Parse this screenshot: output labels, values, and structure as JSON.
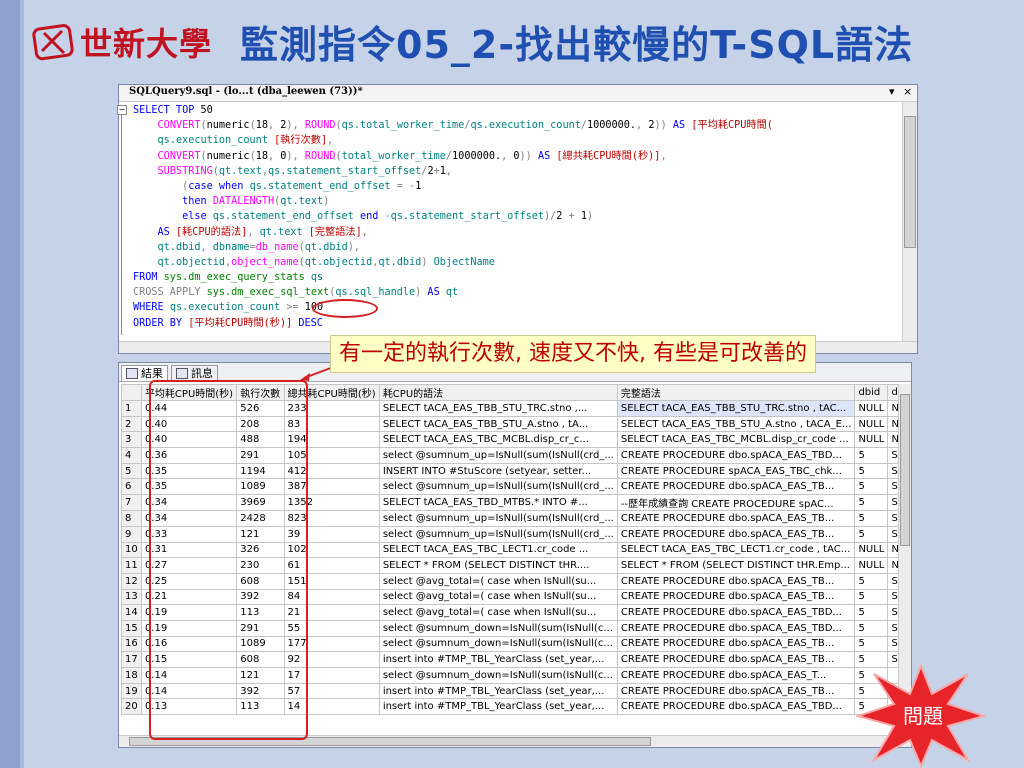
{
  "header": {
    "logo_text": "世新大學",
    "title": "監測指令05_2-找出較慢的T-SQL語法"
  },
  "editor": {
    "tab_name": "SQLQuery9.sql - (lo...t (dba_leewen (73))*",
    "dropdown": "▾",
    "close": "×",
    "lines": [
      [
        [
          "kw",
          "SELECT TOP "
        ],
        [
          "tx",
          "50"
        ]
      ],
      [
        [
          "tx",
          "    "
        ],
        [
          "fn",
          "CONVERT"
        ],
        [
          "gr",
          "("
        ],
        [
          "tx",
          "numeric"
        ],
        [
          "gr",
          "("
        ],
        [
          "tx",
          "18"
        ],
        [
          "gr",
          ", "
        ],
        [
          "tx",
          "2"
        ],
        [
          "gr",
          "), "
        ],
        [
          "fn",
          "ROUND"
        ],
        [
          "gr",
          "("
        ],
        [
          "tl",
          "qs.total_worker_time"
        ],
        [
          "gr",
          "/"
        ],
        [
          "tl",
          "qs.execution_count"
        ],
        [
          "gr",
          "/"
        ],
        [
          "tx",
          "1000000."
        ],
        [
          "gr",
          ", "
        ],
        [
          "tx",
          "2"
        ],
        [
          "gr",
          "))"
        ],
        [
          "kw",
          " AS "
        ],
        [
          "rd",
          "[平均耗CPU時間("
        ]
      ],
      [
        [
          "tx",
          "    "
        ],
        [
          "tl",
          "qs.execution_count"
        ],
        [
          "rd",
          " [執行次數]"
        ],
        [
          "gr",
          ","
        ]
      ],
      [
        [
          "tx",
          "    "
        ],
        [
          "fn",
          "CONVERT"
        ],
        [
          "gr",
          "("
        ],
        [
          "tx",
          "numeric"
        ],
        [
          "gr",
          "("
        ],
        [
          "tx",
          "18"
        ],
        [
          "gr",
          ", "
        ],
        [
          "tx",
          "0"
        ],
        [
          "gr",
          "), "
        ],
        [
          "fn",
          "ROUND"
        ],
        [
          "gr",
          "("
        ],
        [
          "tl",
          "total_worker_time"
        ],
        [
          "gr",
          "/"
        ],
        [
          "tx",
          "1000000."
        ],
        [
          "gr",
          ", "
        ],
        [
          "tx",
          "0"
        ],
        [
          "gr",
          "))"
        ],
        [
          "kw",
          " AS "
        ],
        [
          "rd",
          "[總共耗CPU時間(秒)]"
        ],
        [
          "gr",
          ","
        ]
      ],
      [
        [
          "tx",
          "    "
        ],
        [
          "fn",
          "SUBSTRING"
        ],
        [
          "gr",
          "("
        ],
        [
          "tl",
          "qt.text"
        ],
        [
          "gr",
          ","
        ],
        [
          "tl",
          "qs.statement_start_offset"
        ],
        [
          "gr",
          "/"
        ],
        [
          "tx",
          "2"
        ],
        [
          "gr",
          "+"
        ],
        [
          "tx",
          "1"
        ],
        [
          "gr",
          ","
        ]
      ],
      [
        [
          "tx",
          "        "
        ],
        [
          "gr",
          "("
        ],
        [
          "kw",
          "case when "
        ],
        [
          "tl",
          "qs.statement_end_offset"
        ],
        [
          "gr",
          " = -"
        ],
        [
          "tx",
          "1"
        ]
      ],
      [
        [
          "tx",
          "        "
        ],
        [
          "kw",
          "then "
        ],
        [
          "fn",
          "DATALENGTH"
        ],
        [
          "gr",
          "("
        ],
        [
          "tl",
          "qt.text"
        ],
        [
          "gr",
          ")"
        ]
      ],
      [
        [
          "tx",
          "        "
        ],
        [
          "kw",
          "else "
        ],
        [
          "tl",
          "qs.statement_end_offset"
        ],
        [
          "kw",
          " end "
        ],
        [
          "gr",
          "-"
        ],
        [
          "tl",
          "qs.statement_start_offset"
        ],
        [
          "gr",
          ")/"
        ],
        [
          "tx",
          "2"
        ],
        [
          "gr",
          " + "
        ],
        [
          "tx",
          "1"
        ],
        [
          "gr",
          ")"
        ]
      ],
      [
        [
          "tx",
          "    "
        ],
        [
          "kw",
          "AS "
        ],
        [
          "rd",
          "[耗CPU的語法]"
        ],
        [
          "gr",
          ", "
        ],
        [
          "tl",
          "qt.text"
        ],
        [
          "rd",
          " [完整語法]"
        ],
        [
          "gr",
          ","
        ]
      ],
      [
        [
          "tx",
          "    "
        ],
        [
          "tl",
          "qt.dbid"
        ],
        [
          "gr",
          ", "
        ],
        [
          "tl",
          "dbname"
        ],
        [
          "gr",
          "="
        ],
        [
          "fn",
          "db_name"
        ],
        [
          "gr",
          "("
        ],
        [
          "tl",
          "qt.dbid"
        ],
        [
          "gr",
          "),"
        ]
      ],
      [
        [
          "tx",
          "    "
        ],
        [
          "tl",
          "qt.objectid"
        ],
        [
          "gr",
          ","
        ],
        [
          "fn",
          "object_name"
        ],
        [
          "gr",
          "("
        ],
        [
          "tl",
          "qt.objectid"
        ],
        [
          "gr",
          ","
        ],
        [
          "tl",
          "qt.dbid"
        ],
        [
          "gr",
          ") "
        ],
        [
          "tl",
          "ObjectName"
        ]
      ],
      [
        [
          "kw",
          "FROM "
        ],
        [
          "sys",
          "sys.dm_exec_query_stats"
        ],
        [
          "tl",
          " qs"
        ]
      ],
      [
        [
          "gr",
          "CROSS APPLY "
        ],
        [
          "sys",
          "sys.dm_exec_sql_text"
        ],
        [
          "gr",
          "("
        ],
        [
          "tl",
          "qs.sql_handle"
        ],
        [
          "gr",
          ")"
        ],
        [
          "kw",
          " AS "
        ],
        [
          "tl",
          "qt"
        ]
      ],
      [
        [
          "kw",
          "WHERE "
        ],
        [
          "tl",
          "qs.execution_count "
        ],
        [
          "gr",
          ">= "
        ],
        [
          "tx",
          "100"
        ]
      ],
      [
        [
          "kw",
          "ORDER BY "
        ],
        [
          "rd",
          "[平均耗CPU時間(秒)]"
        ],
        [
          "kw",
          " DESC"
        ]
      ]
    ]
  },
  "callout": "有一定的執行次數, 速度又不快, 有些是可改善的",
  "results": {
    "tab_results": "結果",
    "tab_messages": "訊息",
    "columns": [
      "",
      "平均耗CPU時間(秒)",
      "執行次數",
      "總共耗CPU時間(秒)",
      "耗CPU的語法",
      "完整語法",
      "dbid",
      "dbi"
    ],
    "rows": [
      [
        "1",
        "0.44",
        "526",
        "233",
        "SELECT tACA_EAS_TBB_STU_TRC.stno ,...",
        "SELECT tACA_EAS_TBB_STU_TRC.stno , tAC...",
        "NULL",
        "NU"
      ],
      [
        "2",
        "0.40",
        "208",
        "83",
        "SELECT tACA_EAS_TBB_STU_A.stno , tA...",
        "SELECT tACA_EAS_TBB_STU_A.stno , tACA_E...",
        "NULL",
        "NU"
      ],
      [
        "3",
        "0.40",
        "488",
        "194",
        "SELECT tACA_EAS_TBC_MCBL.disp_cr_c...",
        "SELECT tACA_EAS_TBC_MCBL.disp_cr_code ...",
        "NULL",
        "NU"
      ],
      [
        "4",
        "0.36",
        "291",
        "105",
        "select @sumnum_up=IsNull(sum(IsNull(crd_...",
        "CREATE PROCEDURE dbo.spACA_EAS_TBD...",
        "5",
        "SH"
      ],
      [
        "5",
        "0.35",
        "1194",
        "412",
        "INSERT INTO #StuScore    (setyear, setter...",
        "CREATE PROCEDURE spACA_EAS_TBC_chk...",
        "5",
        "SH"
      ],
      [
        "6",
        "0.35",
        "1089",
        "387",
        "select @sumnum_up=IsNull(sum(IsNull(crd_...",
        "CREATE  PROCEDURE dbo.spACA_EAS_TB...",
        "5",
        "SH"
      ],
      [
        "7",
        "0.34",
        "3969",
        "1352",
        "SELECT tACA_EAS_TBD_MTBS.* INTO #...",
        "--歷年成績查詢  CREATE PROCEDURE spAC...",
        "5",
        "SH"
      ],
      [
        "8",
        "0.34",
        "2428",
        "823",
        "select @sumnum_up=IsNull(sum(IsNull(crd_...",
        "CREATE PROCEDURE dbo.spACA_EAS_TB...",
        "5",
        "SH"
      ],
      [
        "9",
        "0.33",
        "121",
        "39",
        "select @sumnum_up=IsNull(sum(IsNull(crd_...",
        "CREATE PROCEDURE dbo.spACA_EAS_TB...",
        "5",
        "SH"
      ],
      [
        "10",
        "0.31",
        "326",
        "102",
        "SELECT tACA_EAS_TBC_LECT1.cr_code ...",
        "SELECT tACA_EAS_TBC_LECT1.cr_code , tAC...",
        "NULL",
        "NU"
      ],
      [
        "11",
        "0.27",
        "230",
        "61",
        "SELECT * FROM (SELECT DISTINCT tHR....",
        "SELECT * FROM (SELECT DISTINCT tHR.Emp...",
        "NULL",
        "NU"
      ],
      [
        "12",
        "0.25",
        "608",
        "151",
        "select @avg_total=(    case when IsNull(su...",
        "CREATE PROCEDURE dbo.spACA_EAS_TB...",
        "5",
        "SH"
      ],
      [
        "13",
        "0.21",
        "392",
        "84",
        "select @avg_total=(    case when IsNull(su...",
        "CREATE  PROCEDURE dbo.spACA_EAS_TB...",
        "5",
        "SH"
      ],
      [
        "14",
        "0.19",
        "113",
        "21",
        "select @avg_total=(    case when IsNull(su...",
        "CREATE PROCEDURE dbo.spACA_EAS_TBD...",
        "5",
        "SH"
      ],
      [
        "15",
        "0.19",
        "291",
        "55",
        "select @sumnum_down=IsNull(sum(IsNull(c...",
        "CREATE PROCEDURE dbo.spACA_EAS_TBD...",
        "5",
        "SH"
      ],
      [
        "16",
        "0.16",
        "1089",
        "177",
        "select @sumnum_down=IsNull(sum(IsNull(c...",
        "CREATE  PROCEDURE dbo.spACA_EAS_TB...",
        "5",
        "SH"
      ],
      [
        "17",
        "0.15",
        "608",
        "92",
        "insert into #TMP_TBL_YearClass (set_year,...",
        "CREATE PROCEDURE dbo.spACA_EAS_TB...",
        "5",
        "SH"
      ],
      [
        "18",
        "0.14",
        "121",
        "17",
        "select @sumnum_down=IsNull(sum(IsNull(c...",
        "CREATE PROCEDURE dbo.spACA_EAS_T...",
        "5",
        ""
      ],
      [
        "19",
        "0.14",
        "392",
        "57",
        "insert into #TMP_TBL_YearClass (set_year,...",
        "CREATE  PROCEDURE dbo.spACA_EAS_TB...",
        "5",
        ""
      ],
      [
        "20",
        "0.13",
        "113",
        "14",
        "insert into #TMP_TBL_YearClass (set_year,...",
        "CREATE PROCEDURE dbo.spACA_EAS_TBD...",
        "5",
        ""
      ]
    ]
  },
  "star_label": "問題",
  "colors": {
    "title": "#1f4fb0",
    "logo": "#c1121f",
    "callout_text": "#c00000",
    "highlight": "#d42020"
  }
}
